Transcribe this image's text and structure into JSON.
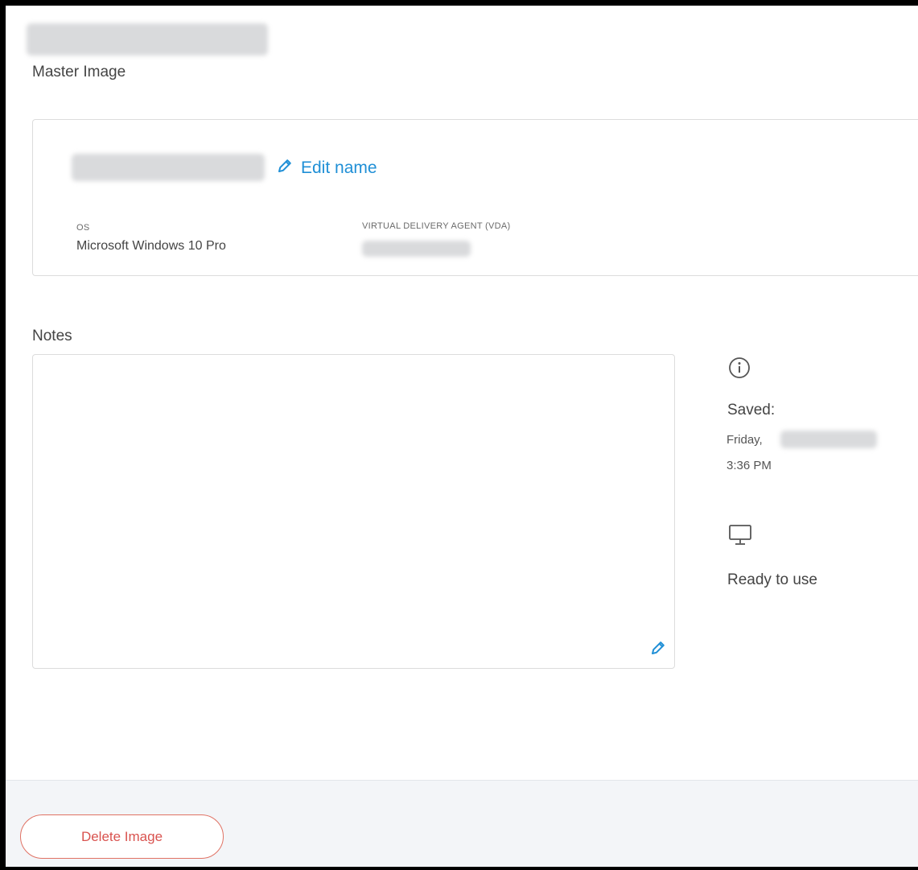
{
  "header": {
    "subtitle": "Master Image"
  },
  "image_card": {
    "edit_name_label": "Edit name",
    "os_label": "OS",
    "os_value": "Microsoft Windows 10 Pro",
    "vda_label": "VIRTUAL DELIVERY AGENT (VDA)"
  },
  "notes": {
    "label": "Notes",
    "value": ""
  },
  "status": {
    "saved_label": "Saved:",
    "saved_day": "Friday,",
    "saved_time": "3:36 PM",
    "ready_label": "Ready to use"
  },
  "footer": {
    "delete_label": "Delete Image"
  },
  "colors": {
    "link": "#1f8fd6",
    "danger": "#d9534f",
    "footer_bg": "#f3f5f8"
  },
  "icons": {
    "edit": "pencil-icon",
    "info": "info-icon",
    "status": "monitor-icon"
  }
}
